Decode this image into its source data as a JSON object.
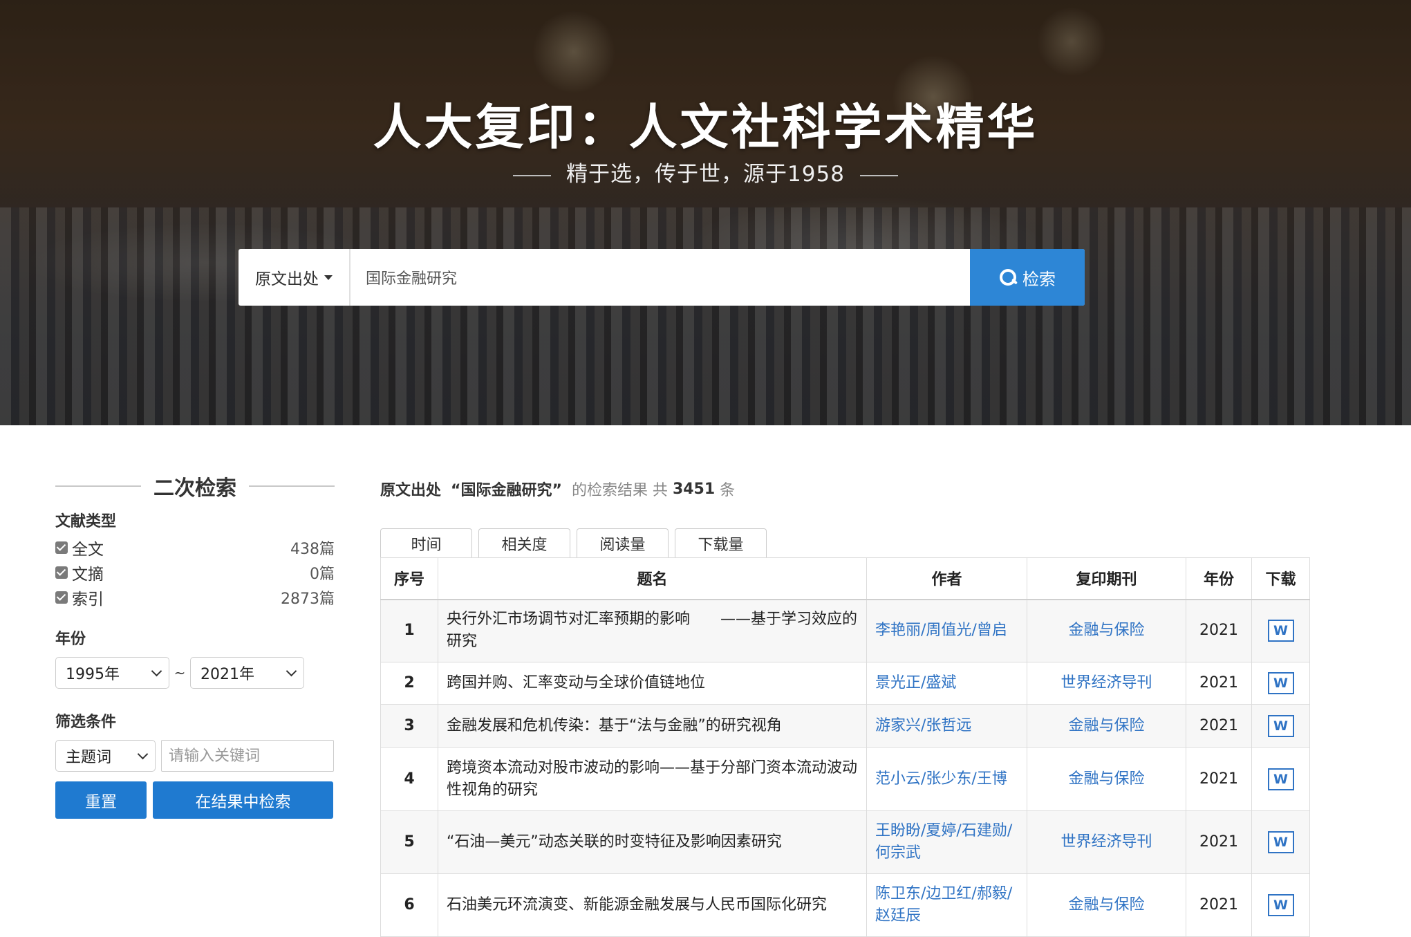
{
  "hero": {
    "title": "人大复印：人文社科学术精华",
    "subtitle": "精于选，传于世，源于1958"
  },
  "search": {
    "field_label": "原文出处",
    "query": "国际金融研究",
    "button_label": "检索"
  },
  "sidebar": {
    "heading": "二次检索",
    "doc_type_label": "文献类型",
    "doc_types": [
      {
        "label": "全文",
        "count": "438篇"
      },
      {
        "label": "文摘",
        "count": "0篇"
      },
      {
        "label": "索引",
        "count": "2873篇"
      }
    ],
    "year_label": "年份",
    "year_from": "1995年",
    "year_sep": "~",
    "year_to": "2021年",
    "filter_label": "筛选条件",
    "filter_field": "主题词",
    "keyword_placeholder": "请输入关键词",
    "reset_label": "重置",
    "search_in_results_label": "在结果中检索"
  },
  "results": {
    "field": "原文出处",
    "query_quoted": "“国际金融研究”",
    "middle_text": "的检索结果 共",
    "total": "3451",
    "unit": "条",
    "sort_tabs": [
      "时间",
      "相关度",
      "阅读量",
      "下载量"
    ],
    "columns": [
      "序号",
      "题名",
      "作者",
      "复印期刊",
      "年份",
      "下载"
    ],
    "rows": [
      {
        "no": "1",
        "title": "央行外汇市场调节对汇率预期的影响　　——基于学习效应的研究",
        "author": "李艳丽/周值光/曾启",
        "journal": "金融与保险",
        "year": "2021",
        "download": "W"
      },
      {
        "no": "2",
        "title": "跨国并购、汇率变动与全球价值链地位",
        "author": "景光正/盛斌",
        "journal": "世界经济导刊",
        "year": "2021",
        "download": "W"
      },
      {
        "no": "3",
        "title": "金融发展和危机传染：基于“法与金融”的研究视角",
        "author": "游家兴/张哲远",
        "journal": "金融与保险",
        "year": "2021",
        "download": "W"
      },
      {
        "no": "4",
        "title": "跨境资本流动对股市波动的影响——基于分部门资本流动波动性视角的研究",
        "author": "范小云/张少东/王博",
        "journal": "金融与保险",
        "year": "2021",
        "download": "W"
      },
      {
        "no": "5",
        "title": "“石油—美元”动态关联的时变特征及影响因素研究",
        "author": "王盼盼/夏婷/石建勋/何宗武",
        "journal": "世界经济导刊",
        "year": "2021",
        "download": "W"
      },
      {
        "no": "6",
        "title": "石油美元环流演变、新能源金融发展与人民币国际化研究",
        "author": "陈卫东/边卫红/郝毅/赵廷辰",
        "journal": "金融与保险",
        "year": "2021",
        "download": "W"
      }
    ]
  },
  "colors": {
    "accent": "#2d86d6",
    "button": "#1f7ad0",
    "link": "#2f73c4"
  }
}
